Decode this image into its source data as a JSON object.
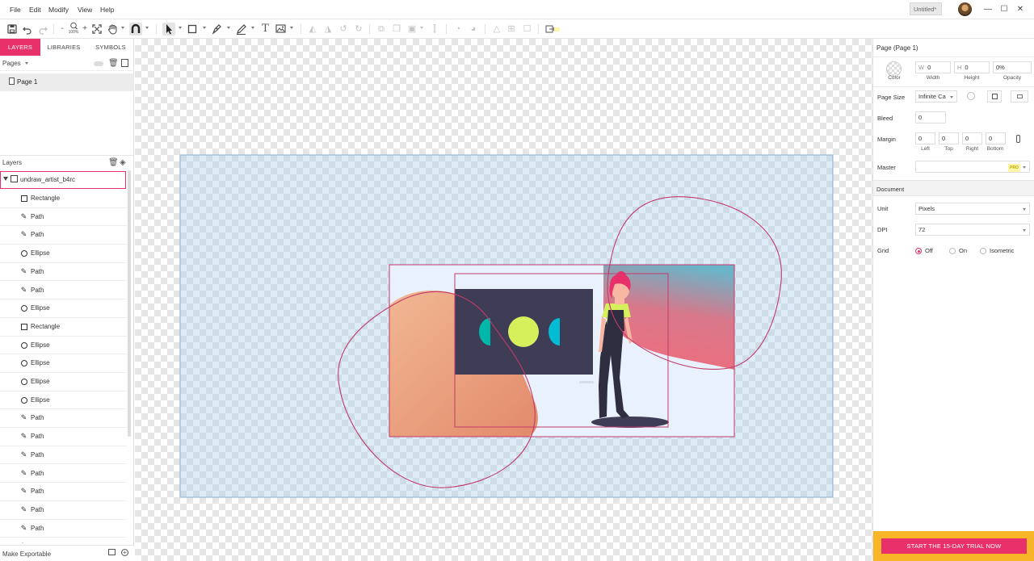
{
  "menu": [
    "File",
    "Edit",
    "Modify",
    "View",
    "Help"
  ],
  "document_tab": "Untitled*",
  "window_controls": {
    "minimize": "—",
    "maximize": "☐",
    "close": "✕"
  },
  "toolbar": {
    "zoom_label": "100%"
  },
  "left_panel": {
    "tabs": [
      "LAYERS",
      "LIBRARIES",
      "SYMBOLS"
    ],
    "pages_label": "Pages",
    "page_items": [
      "Page 1"
    ],
    "layers_label": "Layers",
    "root_layer": "undraw_artist_b4rc",
    "layers": [
      {
        "type": "rect",
        "name": "Rectangle"
      },
      {
        "type": "path",
        "name": "Path"
      },
      {
        "type": "path",
        "name": "Path"
      },
      {
        "type": "ellipse",
        "name": "Ellipse"
      },
      {
        "type": "path",
        "name": "Path"
      },
      {
        "type": "path",
        "name": "Path"
      },
      {
        "type": "ellipse",
        "name": "Ellipse"
      },
      {
        "type": "rect",
        "name": "Rectangle"
      },
      {
        "type": "ellipse",
        "name": "Ellipse"
      },
      {
        "type": "ellipse",
        "name": "Ellipse"
      },
      {
        "type": "ellipse",
        "name": "Ellipse"
      },
      {
        "type": "ellipse",
        "name": "Ellipse"
      },
      {
        "type": "path",
        "name": "Path"
      },
      {
        "type": "path",
        "name": "Path"
      },
      {
        "type": "path",
        "name": "Path"
      },
      {
        "type": "path",
        "name": "Path"
      },
      {
        "type": "path",
        "name": "Path"
      },
      {
        "type": "path",
        "name": "Path"
      },
      {
        "type": "path",
        "name": "Path"
      },
      {
        "type": "path",
        "name": "Path"
      }
    ],
    "make_exportable": "Make Exportable"
  },
  "right_panel": {
    "title": "Page (Page 1)",
    "color_label": "Color",
    "width": {
      "prefix": "W",
      "value": "0",
      "label": "Width"
    },
    "height": {
      "prefix": "H",
      "value": "0",
      "label": "Height"
    },
    "opacity": {
      "value": "0%",
      "label": "Opacity"
    },
    "page_size_label": "Page Size",
    "page_size_value": "Infinite Ca",
    "bleed_label": "Bleed",
    "bleed_value": "0",
    "margin_label": "Margin",
    "margin": [
      {
        "value": "0",
        "label": "Left"
      },
      {
        "value": "0",
        "label": "Top"
      },
      {
        "value": "0",
        "label": "Right"
      },
      {
        "value": "0",
        "label": "Bottom"
      }
    ],
    "master_label": "Master",
    "pro_badge": "PRO",
    "document_section": "Document",
    "unit_label": "Unit",
    "unit_value": "Pixels",
    "dpi_label": "DPI",
    "dpi_value": "72",
    "grid_label": "Grid",
    "grid_options": [
      "Off",
      "On",
      "Isometric"
    ],
    "grid_selected": "Off",
    "trial_button": "START THE 15-DAY TRIAL NOW"
  },
  "colors": {
    "accent": "#e8306a",
    "trial_bg": "#f8b528",
    "monitor": "#3f3d56",
    "highlight": "#d5f05a",
    "teal": "#00b8a9",
    "cyan": "#00bcd4"
  }
}
